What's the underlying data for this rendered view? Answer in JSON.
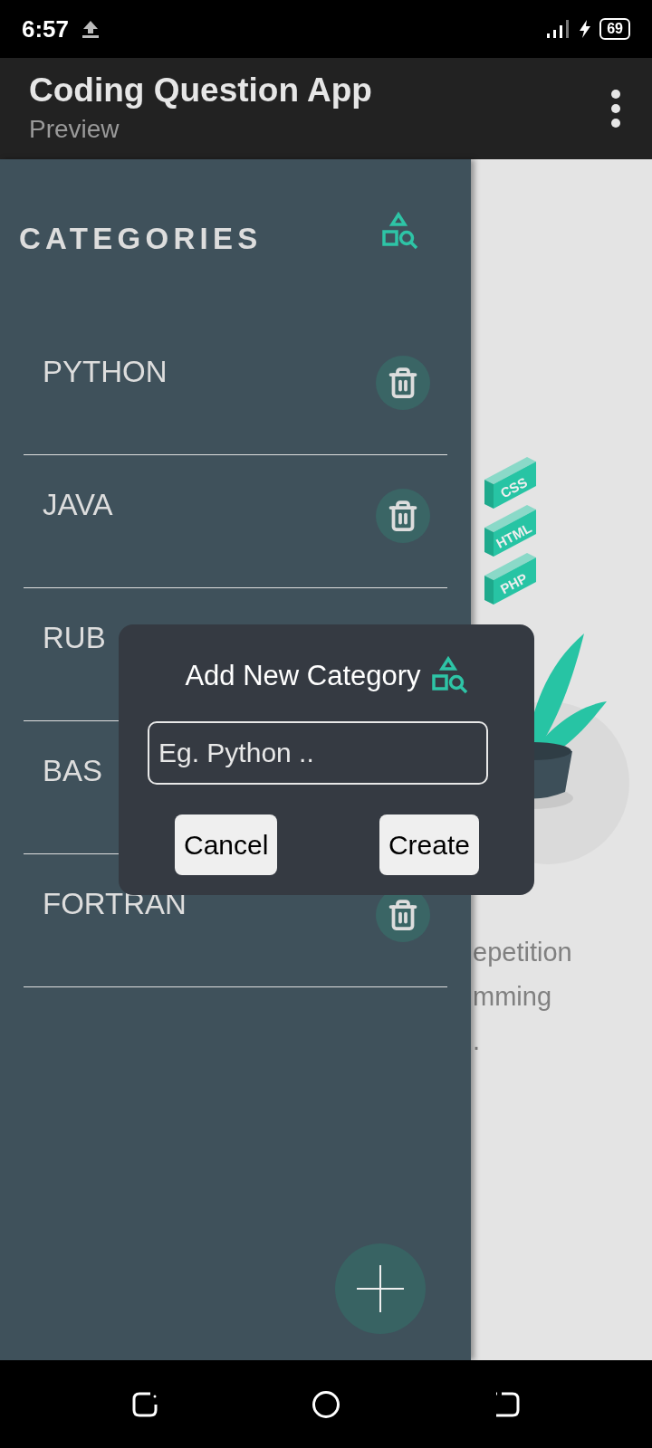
{
  "status_bar": {
    "time": "6:57",
    "battery": "69"
  },
  "app_bar": {
    "title": "Coding Question App",
    "subtitle": "Preview"
  },
  "drawer": {
    "title": "CATEGORIES",
    "items": [
      {
        "kind": "deletable",
        "label": "PYTHON"
      },
      {
        "kind": "deletable",
        "label": "JAVA"
      },
      {
        "kind": "label",
        "label": "RUB"
      },
      {
        "kind": "label",
        "label": "BAS"
      },
      {
        "kind": "deletable",
        "label": "FORTRAN"
      }
    ]
  },
  "illustration": {
    "tags": [
      "CSS",
      "HTML",
      "PHP"
    ]
  },
  "background_text": [
    "epetition",
    "mming",
    "."
  ],
  "dialog": {
    "title": "Add New Category",
    "input": {
      "placeholder": "Eg. Python .."
    },
    "buttons": [
      "Cancel",
      "Create"
    ]
  }
}
